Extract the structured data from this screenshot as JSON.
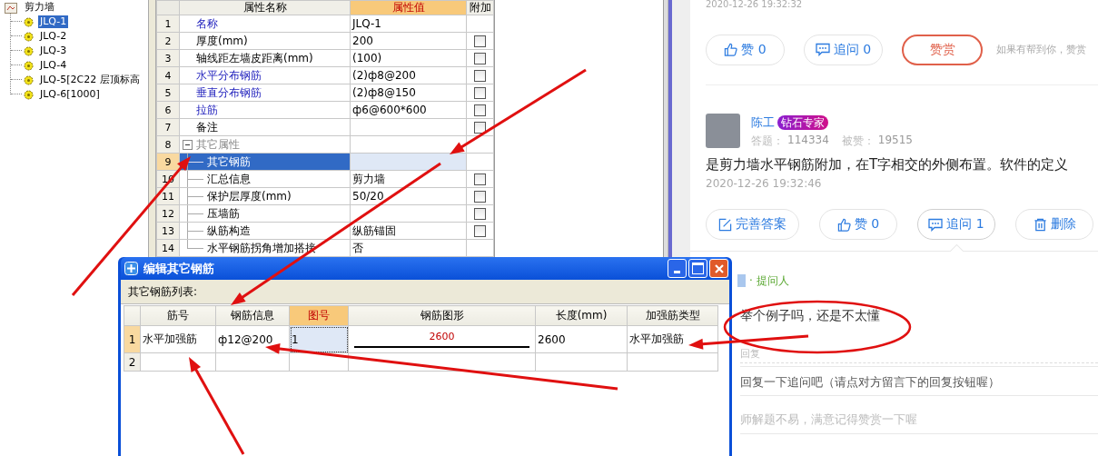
{
  "tree": {
    "label": "剪力墙",
    "children": [
      {
        "label": "JLQ-1",
        "selected": true
      },
      {
        "label": "JLQ-2",
        "selected": false
      },
      {
        "label": "JLQ-3",
        "selected": false
      },
      {
        "label": "JLQ-4",
        "selected": false
      },
      {
        "label": "JLQ-5[2C22 层顶标高",
        "selected": false
      },
      {
        "label": "JLQ-6[1000]",
        "selected": false
      }
    ]
  },
  "property_grid": {
    "columns": [
      {
        "label": "属性名称",
        "selected": false
      },
      {
        "label": "属性值",
        "selected": true
      },
      {
        "label": "附加",
        "selected": false
      }
    ],
    "rows": [
      {
        "kind": "item",
        "number": "1",
        "name": "名称",
        "value": "JLQ-1",
        "emphasis": true,
        "selected": false
      },
      {
        "kind": "item",
        "number": "2",
        "name": "厚度(mm)",
        "value": "200",
        "emphasis": false,
        "selected": false,
        "checked": false
      },
      {
        "kind": "item",
        "number": "3",
        "name": "轴线距左墙皮距离(mm)",
        "value": "(100)",
        "emphasis": false,
        "selected": false,
        "checked": false
      },
      {
        "kind": "item",
        "number": "4",
        "name": "水平分布钢筋",
        "value": "(2)ф8@200",
        "emphasis": true,
        "selected": false,
        "checked": false
      },
      {
        "kind": "item",
        "number": "5",
        "name": "垂直分布钢筋",
        "value": "(2)ф8@150",
        "emphasis": true,
        "selected": false,
        "checked": false
      },
      {
        "kind": "item",
        "number": "6",
        "name": "拉筋",
        "value": "ф6@600*600",
        "emphasis": true,
        "selected": false,
        "checked": false
      },
      {
        "kind": "item",
        "number": "7",
        "name": "备注",
        "emphasis": false,
        "selected": false,
        "checked": false
      },
      {
        "kind": "group",
        "number": "8",
        "name": "其它属性",
        "expanded": true,
        "selected": false,
        "children": [
          {
            "kind": "item",
            "number": "9",
            "name": "其它钢筋",
            "emphasis": false,
            "selected": true
          },
          {
            "kind": "item",
            "number": "10",
            "name": "汇总信息",
            "value": "剪力墙",
            "emphasis": false,
            "selected": false,
            "checked": false
          },
          {
            "kind": "item",
            "number": "11",
            "name": "保护层厚度(mm)",
            "value": "50/20",
            "emphasis": false,
            "selected": false,
            "checked": false
          },
          {
            "kind": "item",
            "number": "12",
            "name": "压墙筋",
            "emphasis": false,
            "selected": false,
            "checked": false
          },
          {
            "kind": "item",
            "number": "13",
            "name": "纵筋构造",
            "value": "纵筋锚固",
            "emphasis": false,
            "selected": false,
            "checked": false
          },
          {
            "kind": "item",
            "number": "14",
            "name": "水平钢筋拐角增加搭接",
            "value": "否",
            "emphasis": false,
            "selected": false
          }
        ]
      }
    ]
  },
  "dialog": {
    "title": "编辑其它钢筋",
    "list_label": "其它钢筋列表:",
    "columns": [
      {
        "label": "筋号",
        "selected": false
      },
      {
        "label": "钢筋信息",
        "selected": false
      },
      {
        "label": "图号",
        "selected": true
      },
      {
        "label": "钢筋图形",
        "selected": false
      },
      {
        "label": "长度(mm)",
        "selected": false
      },
      {
        "label": "加强筋类型",
        "selected": false
      }
    ],
    "rows": [
      {
        "number": "1",
        "selected": true,
        "bar_name": "水平加强筋",
        "bar_info": "ф12@200",
        "shape_no": "1",
        "shape_length": "2600",
        "length": "2600",
        "type": "水平加强筋"
      },
      {
        "number": "2",
        "selected": false
      }
    ]
  },
  "answer_top": {
    "timestamp": "2020-12-26 19:32:32",
    "buttons": [
      {
        "kind": "like",
        "label": "赞 0"
      },
      {
        "kind": "ask",
        "label": "追问  0"
      },
      {
        "kind": "reward",
        "label": "赞赏"
      }
    ],
    "hint": "如果有帮到你，赞赏"
  },
  "answer": {
    "author": "陈工",
    "badge": "钻石专家",
    "stats": [
      {
        "label": "答题：",
        "value": "114334"
      },
      {
        "label": "被赞：",
        "value": "19515"
      }
    ],
    "text": "是剪力墙水平钢筋附加，在T字相交的外侧布置。软件的定义",
    "timestamp": "2020-12-26 19:32:46",
    "buttons": [
      {
        "kind": "edit",
        "label": "完善答案",
        "selected": false
      },
      {
        "kind": "like",
        "label": "赞 0",
        "selected": false
      },
      {
        "kind": "ask",
        "label": "追问 1",
        "selected": true
      },
      {
        "kind": "delete",
        "label": "删除",
        "selected": false
      }
    ]
  },
  "follow_up": {
    "role": "· 提问人",
    "question": "举个例子吗，还是不太懂",
    "reply": "回复",
    "prompt": "回复一下追问吧（请点对方留言下的回复按钮喔）",
    "reminder": "师解题不易，满意记得赞赏一下喔"
  }
}
